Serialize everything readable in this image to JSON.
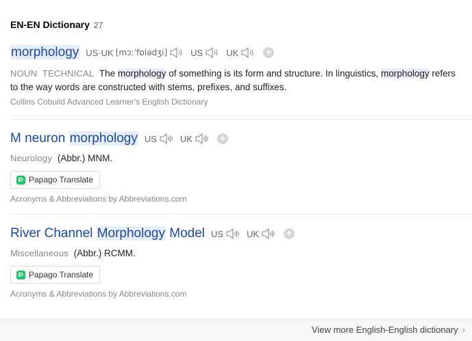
{
  "header": {
    "title": "EN-EN Dictionary",
    "count": "27"
  },
  "entries": [
    {
      "word": "morphology",
      "pron_usuk_label": "US·UK",
      "ipa": "[mɔːˈfɒlədʒi]",
      "us_label": "US",
      "uk_label": "UK",
      "pos": "NOUN",
      "register": "TECHNICAL",
      "def_1": "The",
      "def_hl_1": "morphology",
      "def_2": "of something is its form and structure. In linguistics,",
      "def_hl_2": "morphology",
      "def_3": "refers to the way words are constructed with stems, prefixes, and suffixes.",
      "source": "Collins Cobuild Advanced Learner's English Dictionary"
    },
    {
      "word_pre": "M neuron",
      "word_hl": "morphology",
      "us_label": "US",
      "uk_label": "UK",
      "category": "Neurology",
      "abbr": "(Abbr.) MNM.",
      "translate_label": "Papago Translate",
      "source": "Acronyms & Abbreviations by Abbreviations.com"
    },
    {
      "word_pre": "River Channel",
      "word_hl": "Morphology",
      "word_post": "Model",
      "us_label": "US",
      "uk_label": "UK",
      "category": "Miscellaneous",
      "abbr": "(Abbr.) RCMM.",
      "translate_label": "Papago Translate",
      "source": "Acronyms & Abbreviations by Abbreviations.com"
    }
  ],
  "footer": {
    "more_label": "View more English-English dictionary",
    "chevron": "›"
  },
  "icons": {
    "speaker": "speaker-icon",
    "add": "add-icon",
    "papago": "papago-icon"
  },
  "colors": {
    "link": "#1b49a8",
    "highlight": "#e8eef9",
    "muted": "#888888"
  }
}
